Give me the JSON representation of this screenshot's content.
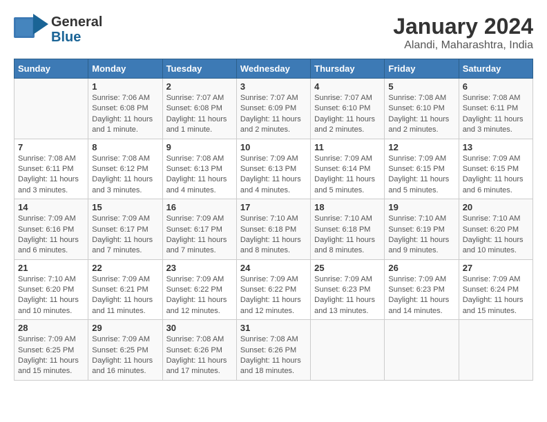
{
  "header": {
    "logo_general": "General",
    "logo_blue": "Blue",
    "title": "January 2024",
    "subtitle": "Alandi, Maharashtra, India"
  },
  "calendar": {
    "days_of_week": [
      "Sunday",
      "Monday",
      "Tuesday",
      "Wednesday",
      "Thursday",
      "Friday",
      "Saturday"
    ],
    "weeks": [
      [
        {
          "day": "",
          "info": ""
        },
        {
          "day": "1",
          "info": "Sunrise: 7:06 AM\nSunset: 6:08 PM\nDaylight: 11 hours\nand 1 minute."
        },
        {
          "day": "2",
          "info": "Sunrise: 7:07 AM\nSunset: 6:08 PM\nDaylight: 11 hours\nand 1 minute."
        },
        {
          "day": "3",
          "info": "Sunrise: 7:07 AM\nSunset: 6:09 PM\nDaylight: 11 hours\nand 2 minutes."
        },
        {
          "day": "4",
          "info": "Sunrise: 7:07 AM\nSunset: 6:10 PM\nDaylight: 11 hours\nand 2 minutes."
        },
        {
          "day": "5",
          "info": "Sunrise: 7:08 AM\nSunset: 6:10 PM\nDaylight: 11 hours\nand 2 minutes."
        },
        {
          "day": "6",
          "info": "Sunrise: 7:08 AM\nSunset: 6:11 PM\nDaylight: 11 hours\nand 3 minutes."
        }
      ],
      [
        {
          "day": "7",
          "info": "Sunrise: 7:08 AM\nSunset: 6:11 PM\nDaylight: 11 hours\nand 3 minutes."
        },
        {
          "day": "8",
          "info": "Sunrise: 7:08 AM\nSunset: 6:12 PM\nDaylight: 11 hours\nand 3 minutes."
        },
        {
          "day": "9",
          "info": "Sunrise: 7:08 AM\nSunset: 6:13 PM\nDaylight: 11 hours\nand 4 minutes."
        },
        {
          "day": "10",
          "info": "Sunrise: 7:09 AM\nSunset: 6:13 PM\nDaylight: 11 hours\nand 4 minutes."
        },
        {
          "day": "11",
          "info": "Sunrise: 7:09 AM\nSunset: 6:14 PM\nDaylight: 11 hours\nand 5 minutes."
        },
        {
          "day": "12",
          "info": "Sunrise: 7:09 AM\nSunset: 6:15 PM\nDaylight: 11 hours\nand 5 minutes."
        },
        {
          "day": "13",
          "info": "Sunrise: 7:09 AM\nSunset: 6:15 PM\nDaylight: 11 hours\nand 6 minutes."
        }
      ],
      [
        {
          "day": "14",
          "info": "Sunrise: 7:09 AM\nSunset: 6:16 PM\nDaylight: 11 hours\nand 6 minutes."
        },
        {
          "day": "15",
          "info": "Sunrise: 7:09 AM\nSunset: 6:17 PM\nDaylight: 11 hours\nand 7 minutes."
        },
        {
          "day": "16",
          "info": "Sunrise: 7:09 AM\nSunset: 6:17 PM\nDaylight: 11 hours\nand 7 minutes."
        },
        {
          "day": "17",
          "info": "Sunrise: 7:10 AM\nSunset: 6:18 PM\nDaylight: 11 hours\nand 8 minutes."
        },
        {
          "day": "18",
          "info": "Sunrise: 7:10 AM\nSunset: 6:18 PM\nDaylight: 11 hours\nand 8 minutes."
        },
        {
          "day": "19",
          "info": "Sunrise: 7:10 AM\nSunset: 6:19 PM\nDaylight: 11 hours\nand 9 minutes."
        },
        {
          "day": "20",
          "info": "Sunrise: 7:10 AM\nSunset: 6:20 PM\nDaylight: 11 hours\nand 10 minutes."
        }
      ],
      [
        {
          "day": "21",
          "info": "Sunrise: 7:10 AM\nSunset: 6:20 PM\nDaylight: 11 hours\nand 10 minutes."
        },
        {
          "day": "22",
          "info": "Sunrise: 7:09 AM\nSunset: 6:21 PM\nDaylight: 11 hours\nand 11 minutes."
        },
        {
          "day": "23",
          "info": "Sunrise: 7:09 AM\nSunset: 6:22 PM\nDaylight: 11 hours\nand 12 minutes."
        },
        {
          "day": "24",
          "info": "Sunrise: 7:09 AM\nSunset: 6:22 PM\nDaylight: 11 hours\nand 12 minutes."
        },
        {
          "day": "25",
          "info": "Sunrise: 7:09 AM\nSunset: 6:23 PM\nDaylight: 11 hours\nand 13 minutes."
        },
        {
          "day": "26",
          "info": "Sunrise: 7:09 AM\nSunset: 6:23 PM\nDaylight: 11 hours\nand 14 minutes."
        },
        {
          "day": "27",
          "info": "Sunrise: 7:09 AM\nSunset: 6:24 PM\nDaylight: 11 hours\nand 15 minutes."
        }
      ],
      [
        {
          "day": "28",
          "info": "Sunrise: 7:09 AM\nSunset: 6:25 PM\nDaylight: 11 hours\nand 15 minutes."
        },
        {
          "day": "29",
          "info": "Sunrise: 7:09 AM\nSunset: 6:25 PM\nDaylight: 11 hours\nand 16 minutes."
        },
        {
          "day": "30",
          "info": "Sunrise: 7:08 AM\nSunset: 6:26 PM\nDaylight: 11 hours\nand 17 minutes."
        },
        {
          "day": "31",
          "info": "Sunrise: 7:08 AM\nSunset: 6:26 PM\nDaylight: 11 hours\nand 18 minutes."
        },
        {
          "day": "",
          "info": ""
        },
        {
          "day": "",
          "info": ""
        },
        {
          "day": "",
          "info": ""
        }
      ]
    ]
  }
}
